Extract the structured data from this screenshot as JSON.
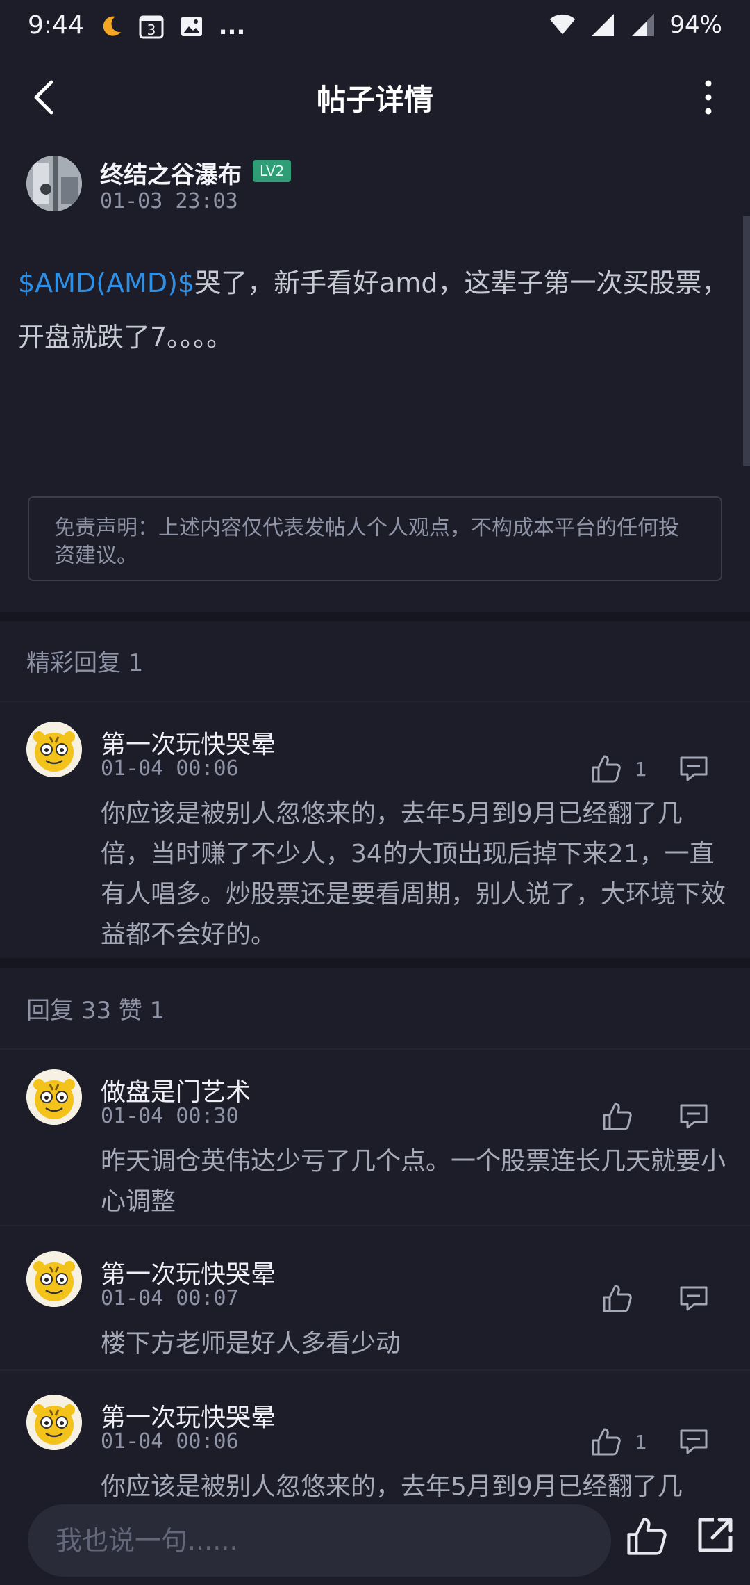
{
  "status_bar": {
    "time": "9:44",
    "calendar_day": "3",
    "more": "...",
    "battery": "94%"
  },
  "nav": {
    "title": "帖子详情"
  },
  "post": {
    "author": "终结之谷瀑布",
    "level": "LV2",
    "time": "01-03 23:03",
    "stock_tag": "$AMD(AMD)$",
    "content": "哭了，新手看好amd，这辈子第一次买股票，开盘就跌了7。。。。",
    "disclaimer": "免责声明：上述内容仅代表发帖人个人观点，不构成本平台的任何投资建议。"
  },
  "featured_section": {
    "title": "精彩回复 1"
  },
  "featured_comments": [
    {
      "name": "第一次玩快哭晕",
      "time": "01-04 00:06",
      "likes": "1",
      "body": "你应该是被别人忽悠来的，去年5月到9月已经翻了几倍，当时赚了不少人，34的大顶出现后掉下来21，一直有人唱多。炒股票还是要看周期，别人说了，大环境下效益都不会好的。"
    }
  ],
  "replies_section": {
    "title": "回复 33 赞 1"
  },
  "replies": [
    {
      "name": "做盘是门艺术",
      "time": "01-04 00:30",
      "likes": "",
      "body": "昨天调仓英伟达少亏了几个点。一个股票连长几天就要小心调整"
    },
    {
      "name": "第一次玩快哭晕",
      "time": "01-04 00:07",
      "likes": "",
      "body": "楼下方老师是好人多看少动"
    },
    {
      "name": "第一次玩快哭晕",
      "time": "01-04 00:06",
      "likes": "1",
      "body": "你应该是被别人忽悠来的，去年5月到9月已经翻了几"
    }
  ],
  "bottom_bar": {
    "input_placeholder": "我也说一句......"
  },
  "colors": {
    "background": "#1c1d29",
    "link": "#2d8fe6",
    "badge": "#2f9e76",
    "muted": "#8f93a6"
  }
}
